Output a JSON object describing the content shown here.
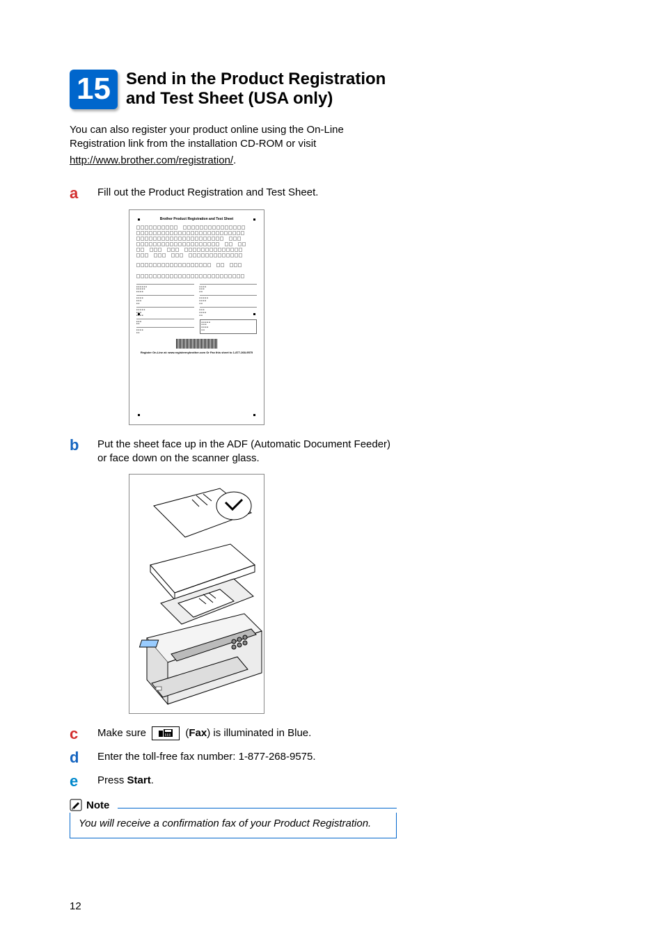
{
  "step_number": "15",
  "step_title": "Send in the Product Registration and Test Sheet (USA only)",
  "intro": {
    "line1": "You can also register your product online using the On-Line Registration link from the installation CD-ROM or visit",
    "link": "http://www.brother.com/registration/",
    "period": "."
  },
  "substeps": {
    "a": {
      "letter": "a",
      "text": "Fill out the Product Registration and Test Sheet."
    },
    "b": {
      "letter": "b",
      "text": "Put the sheet face up in the ADF (Automatic Document Feeder) or face down on the scanner glass."
    },
    "c": {
      "letter": "c",
      "prefix": "Make sure ",
      "mid_open": " (",
      "bold": "Fax",
      "suffix": ") is illuminated in Blue."
    },
    "d": {
      "letter": "d",
      "text": "Enter the toll-free fax number: 1-877-268-9575."
    },
    "e": {
      "letter": "e",
      "prefix": "Press ",
      "bold": "Start",
      "suffix": "."
    }
  },
  "reg_sheet": {
    "title": "Brother Product Registration and Test Sheet",
    "footer": "Register On-Line at: www.registermybrother.com    Or    Fax this sheet to 1-877-268-9575"
  },
  "note": {
    "title": "Note",
    "body": "You will receive a confirmation fax of your Product Registration."
  },
  "icons": {
    "fax": "fax-icon",
    "pencil": "pencil-note-icon"
  },
  "page_number": "12"
}
